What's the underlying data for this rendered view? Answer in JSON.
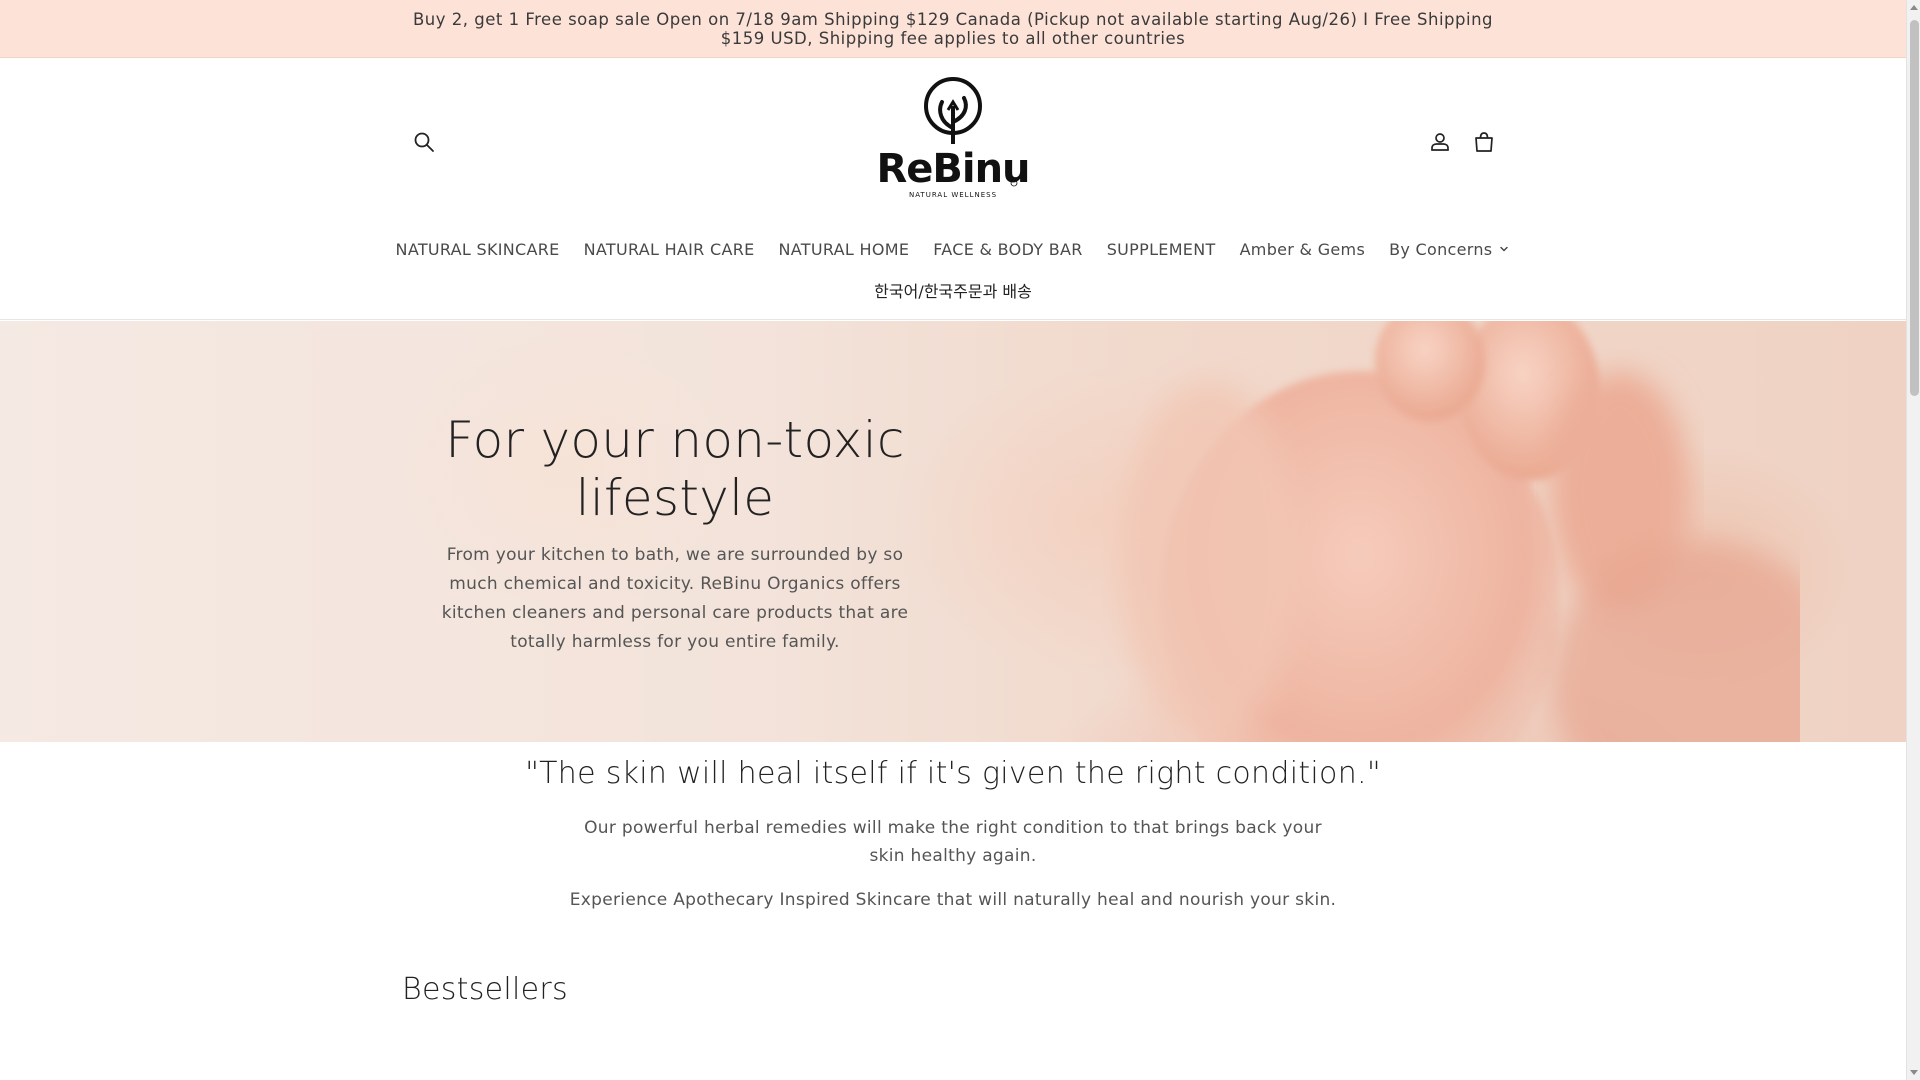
{
  "announcement": {
    "text": "Buy 2, get 1 Free soap sale Open on 7/18 9am Shipping $129 Canada (Pickup not available starting Aug/26) I Free Shipping $159 USD, Shipping fee applies to all other countries"
  },
  "header": {
    "brand_name": "ReBinu",
    "brand_tagline": "NATURAL WELLNESS",
    "icons": {
      "search": "search-icon",
      "account": "user-icon",
      "cart": "bag-icon"
    }
  },
  "nav": {
    "items": [
      {
        "label": "NATURAL SKINCARE"
      },
      {
        "label": "NATURAL HAIR CARE"
      },
      {
        "label": "NATURAL HOME"
      },
      {
        "label": "FACE & BODY BAR"
      },
      {
        "label": "SUPPLEMENT"
      },
      {
        "label": "Amber & Gems"
      },
      {
        "label": "By Concerns"
      }
    ],
    "secondary": "한국어/한국주문과 배송"
  },
  "hero": {
    "title": "For your non-toxic lifestyle",
    "text": "From your kitchen to bath, we are surrounded by so much chemical and toxicity. ReBinu Organics offers kitchen cleaners and personal care products that are totally harmless for you entire family."
  },
  "quote_section": {
    "quote": "\"The skin will heal itself if it's given the right condition.\"",
    "paragraph_1": "Our powerful herbal remedies will make the right condition to that brings back your skin healthy again.",
    "paragraph_2": "Experience Apothecary Inspired Skincare that will naturally heal and nourish your skin."
  },
  "bestsellers": {
    "title": "Bestsellers"
  },
  "colors": {
    "announcement_bg": "#fde2d8",
    "text": "#222222",
    "muted_text": "#555555"
  }
}
